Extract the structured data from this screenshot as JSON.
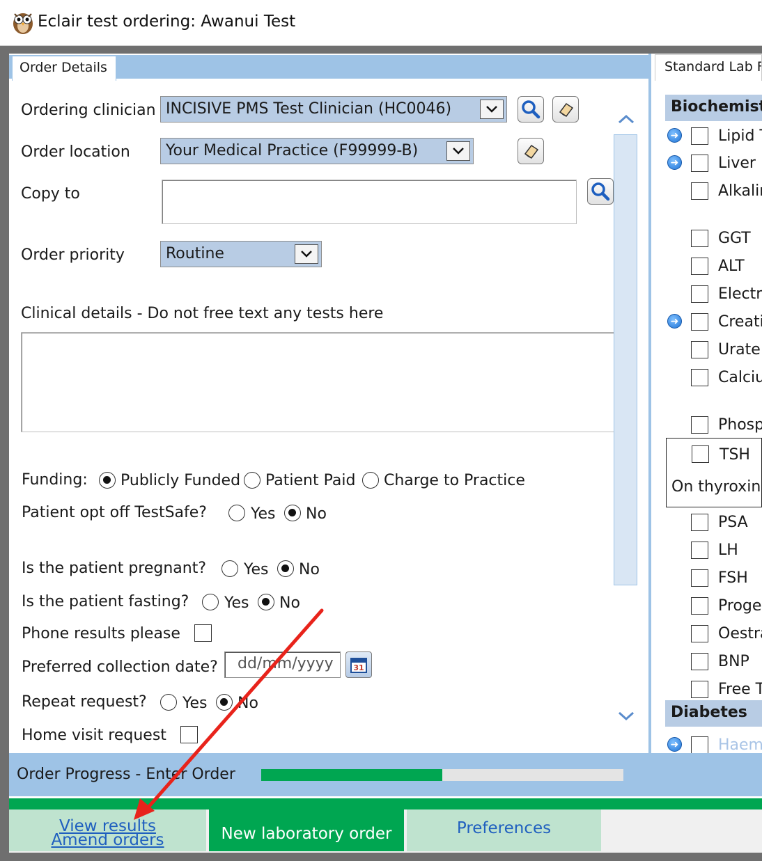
{
  "window": {
    "title": "Eclair test ordering: Awanui Test"
  },
  "tabs": {
    "order_details": "Order Details",
    "standard_lab": "Standard Lab F"
  },
  "form": {
    "ordering_clinician": {
      "label": "Ordering clinician",
      "value": "INCISIVE PMS Test Clinician (HC0046)"
    },
    "order_location": {
      "label": "Order location",
      "value": "Your Medical Practice (F99999-B)"
    },
    "copy_to": {
      "label": "Copy to",
      "value": ""
    },
    "order_priority": {
      "label": "Order priority",
      "value": "Routine"
    },
    "clinical_details": {
      "label": "Clinical details - Do not free text any tests here",
      "value": ""
    },
    "funding": {
      "label": "Funding:",
      "options": [
        "Publicly Funded",
        "Patient Paid",
        "Charge to Practice"
      ],
      "selected": "Publicly Funded"
    },
    "testsafe": {
      "label": "Patient opt off TestSafe?",
      "yes": "Yes",
      "no": "No",
      "selected": "No"
    },
    "pregnant": {
      "label": "Is the patient pregnant?",
      "yes": "Yes",
      "no": "No",
      "selected": "No"
    },
    "fasting": {
      "label": "Is the patient fasting?",
      "yes": "Yes",
      "no": "No",
      "selected": "No"
    },
    "phone_results": {
      "label": "Phone results please",
      "checked": false
    },
    "collection_date": {
      "label": "Preferred collection date?",
      "placeholder": "dd/mm/yyyy",
      "calendar_day": "31"
    },
    "repeat_request": {
      "label": "Repeat request?",
      "yes": "Yes",
      "no": "No",
      "selected": "No"
    },
    "home_visit": {
      "label": "Home visit request",
      "checked": false
    }
  },
  "tests": {
    "biochemistry_header": "Biochemist",
    "items": [
      {
        "label": "Lipid T",
        "info": true
      },
      {
        "label": "Liver F",
        "info": true
      },
      {
        "label": "Alkalin",
        "info": false
      },
      {
        "label": "GGT",
        "info": false
      },
      {
        "label": "ALT",
        "info": false
      },
      {
        "label": "Electro",
        "info": false
      },
      {
        "label": "Creati",
        "info": true
      },
      {
        "label": "Urate",
        "info": false
      },
      {
        "label": "Calciur",
        "info": false
      },
      {
        "label": "Phosp",
        "info": false
      },
      {
        "label": "PSA",
        "info": false
      },
      {
        "label": "LH",
        "info": false
      },
      {
        "label": "FSH",
        "info": false
      },
      {
        "label": "Proge",
        "info": false
      },
      {
        "label": "Oestra",
        "info": false
      },
      {
        "label": "BNP",
        "info": false
      },
      {
        "label": "Free T",
        "info": false
      }
    ],
    "tsh": {
      "label": "TSH",
      "note": "On thyroxine"
    },
    "diabetes_header": "Diabetes",
    "diabetes_first": "Haem"
  },
  "progress": {
    "label": "Order Progress - Enter Order",
    "fraction": 0.5
  },
  "bottom_tabs": {
    "view_results": "View results",
    "amend_orders": "Amend orders",
    "new_order": "New laboratory order",
    "preferences": "Preferences"
  },
  "colors": {
    "accent_blue": "#9ec3e6",
    "select_fill": "#b8cce4",
    "green": "#00a651",
    "annotation_arrow": "#e8231b"
  }
}
